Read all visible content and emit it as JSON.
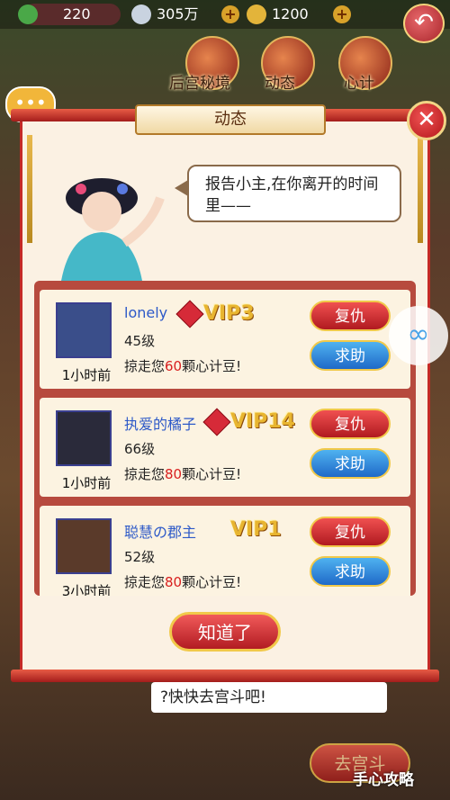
{
  "top_bar": {
    "jade": "220",
    "silver": "305万",
    "gold": "1200",
    "back_icon": "back-arrow-icon"
  },
  "header_tabs": [
    {
      "label": "后宫秘境"
    },
    {
      "label": "动态"
    },
    {
      "label": "心计"
    }
  ],
  "dialog": {
    "title": "动态",
    "speech": "报告小主,在你离开的时间里——",
    "entries": [
      {
        "name": "lonely",
        "vip": "VIP3",
        "level": "45级",
        "time": "1小时前",
        "msg_pre": "掠走您",
        "msg_num": "60",
        "msg_post": "颗心计豆!",
        "gem": true
      },
      {
        "name": "执爱的橘子",
        "vip": "VIP14",
        "level": "66级",
        "time": "1小时前",
        "msg_pre": "掠走您",
        "msg_num": "80",
        "msg_post": "颗心计豆!",
        "gem": true
      },
      {
        "name": "聪慧の郡主",
        "vip": "VIP1",
        "level": "52级",
        "time": "3小时前",
        "msg_pre": "掠走您",
        "msg_num": "80",
        "msg_post": "颗心计豆!",
        "gem": false
      }
    ],
    "revenge_label": "复仇",
    "help_label": "求助",
    "ok_label": "知道了"
  },
  "background": {
    "hint": "?快快去宫斗吧!",
    "fight_label": "去宫斗"
  },
  "watermark": "手心攻略",
  "colors": {
    "accent_red": "#c42a27",
    "vip_gold": "#e8b530",
    "name_blue": "#2d59c8"
  }
}
